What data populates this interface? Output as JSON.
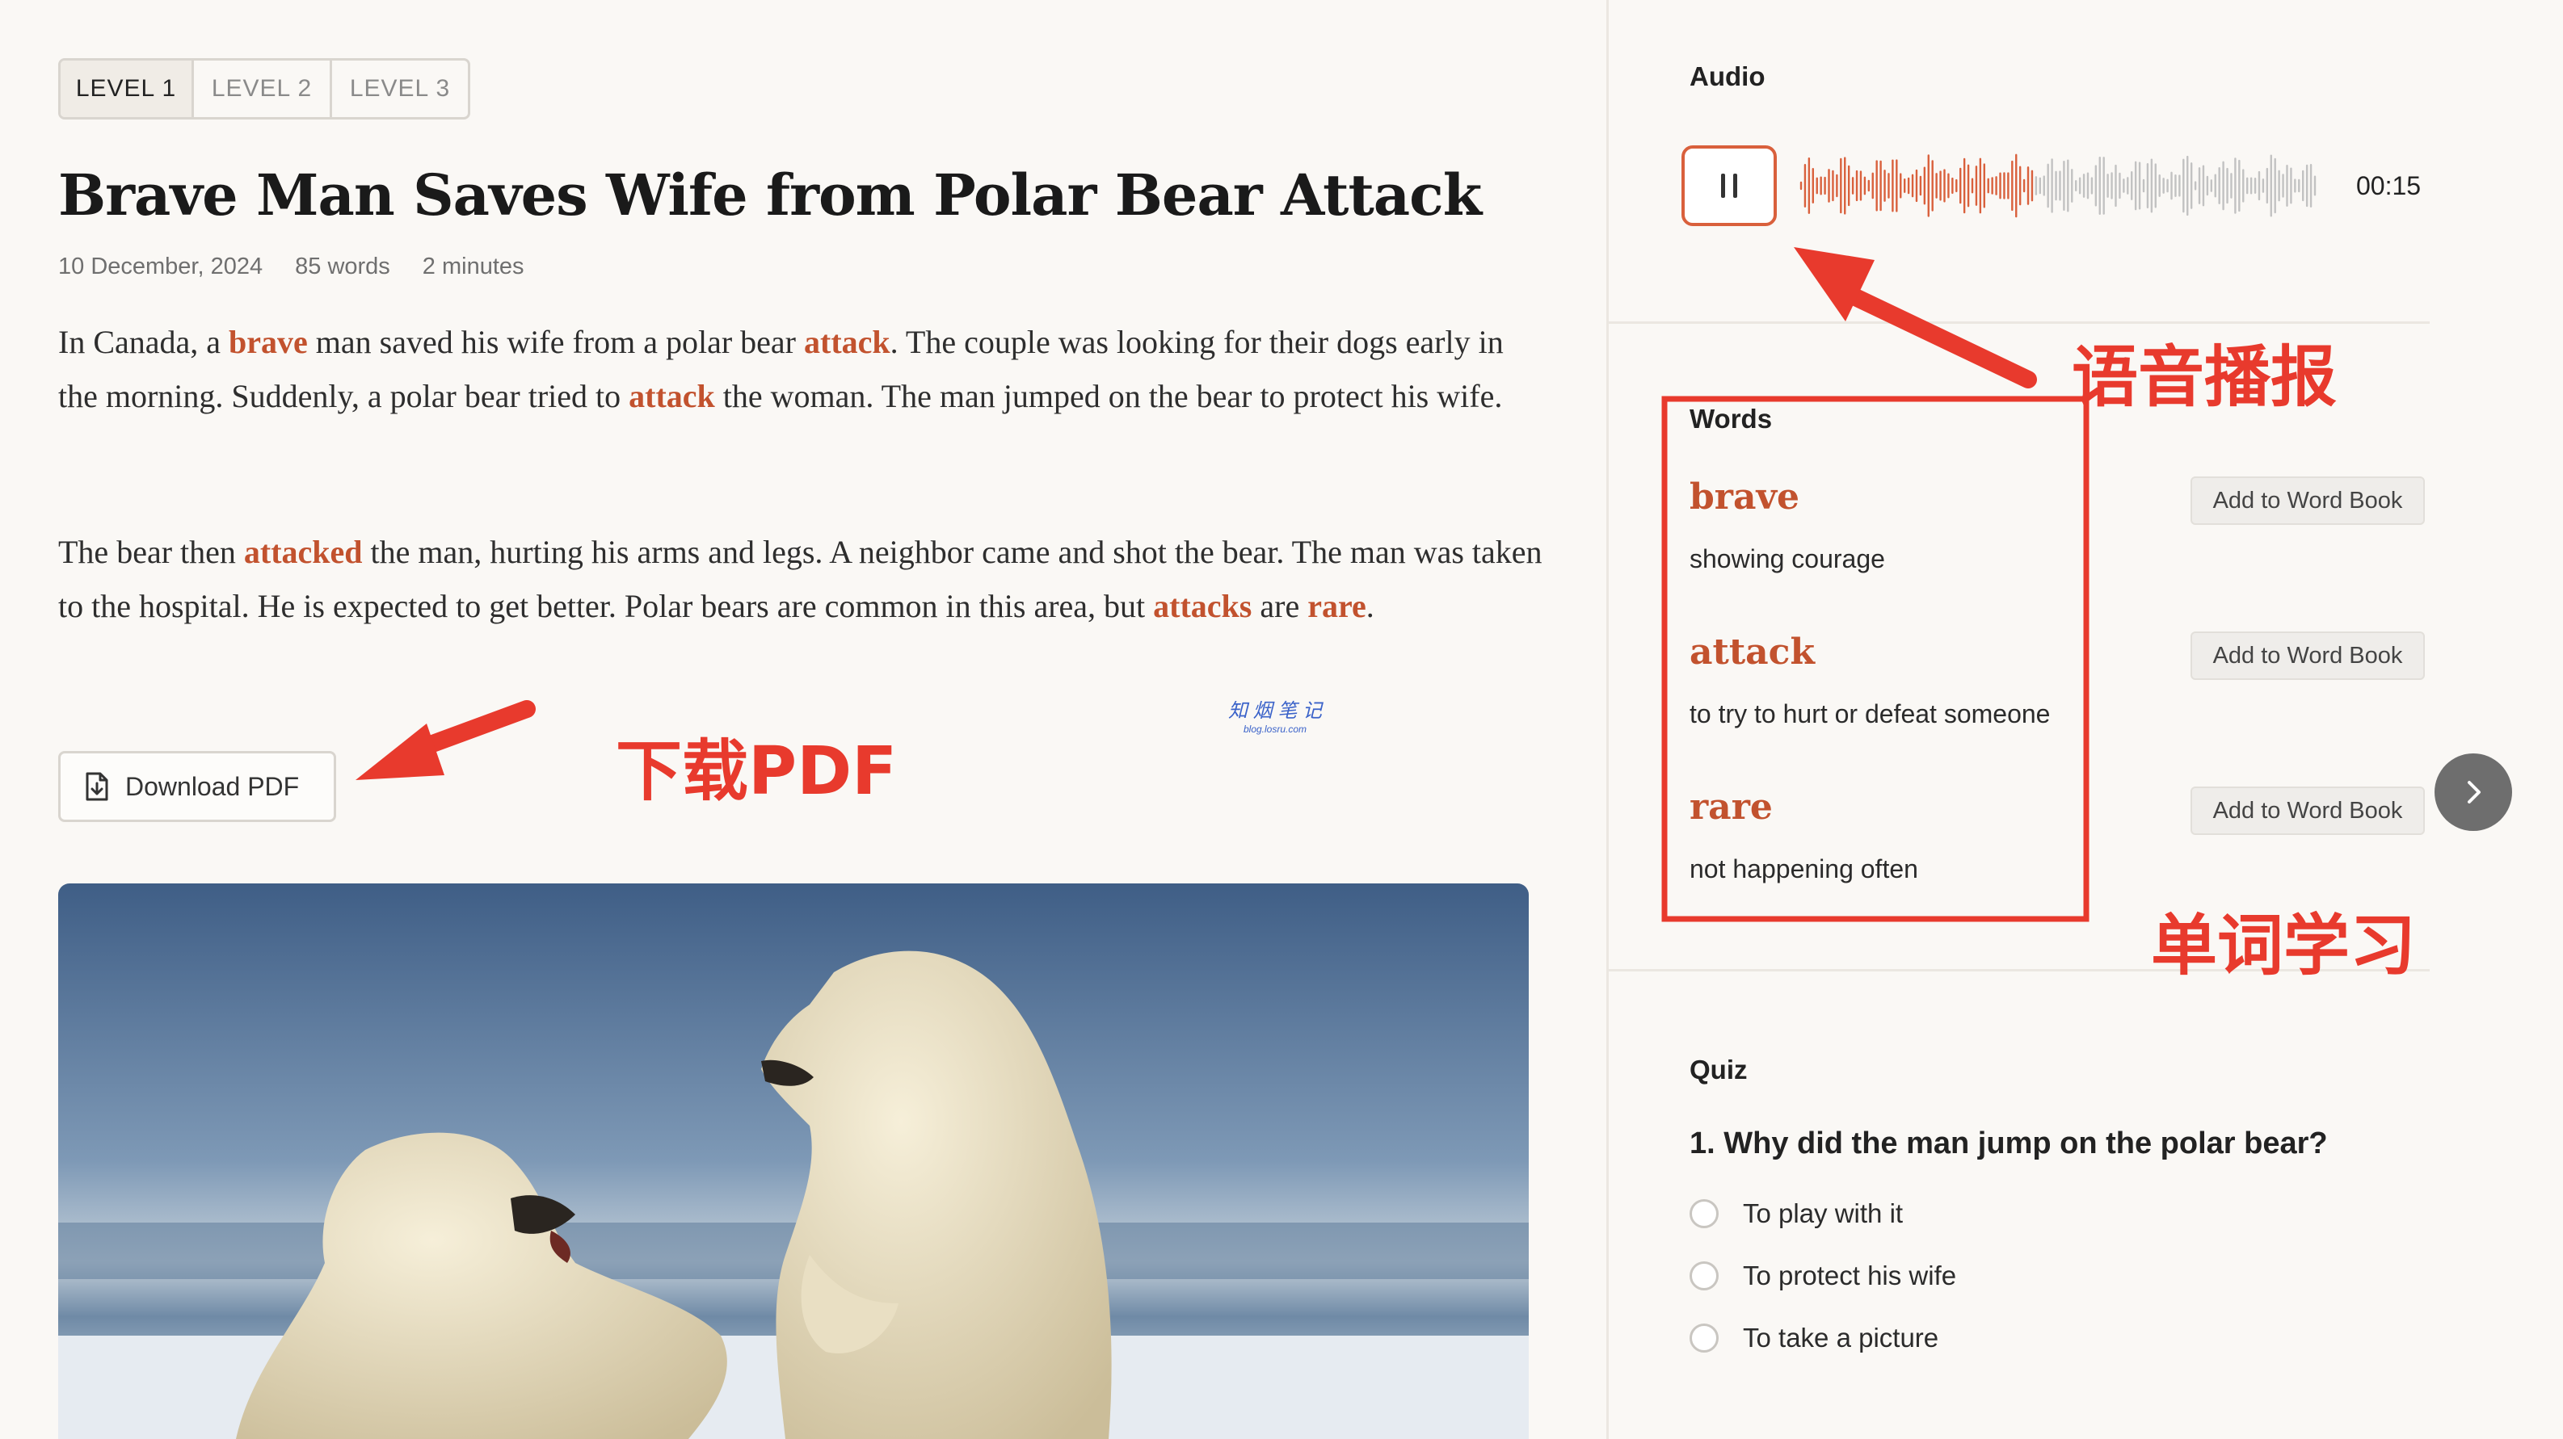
{
  "levels": [
    {
      "label": "LEVEL 1",
      "active": true
    },
    {
      "label": "LEVEL 2",
      "active": false
    },
    {
      "label": "LEVEL 3",
      "active": false
    }
  ],
  "article": {
    "title": "Brave Man Saves Wife from Polar Bear Attack",
    "date": "10 December, 2024",
    "word_count": "85 words",
    "read_time": "2 minutes",
    "p1": {
      "t1": "In Canada, a ",
      "k1": "brave",
      "t2": " man saved his wife from a polar bear ",
      "k2": "attack",
      "t3": ". The couple was looking for their dogs early in the morning. Suddenly, a polar bear tried to ",
      "k3": "attack",
      "t4": " the woman. The man jumped on the bear to protect his wife."
    },
    "p2": {
      "t1": "The bear then ",
      "k1": "attacked",
      "t2": " the man, hurting his arms and legs. A neighbor came and shot the bear. The man was taken to the hospital. He is expected to get better. Polar bears are common in this area, but ",
      "k2": "attacks",
      "t3": " are ",
      "k3": "rare",
      "t4": "."
    },
    "download_label": "Download PDF",
    "watermark_top": "知 烟 笔 记",
    "watermark_bottom": "blog.losru.com"
  },
  "annotations": {
    "download": "下载PDF",
    "audio": "语音播报",
    "words": "单词学习",
    "color": "#e83a2d"
  },
  "audio": {
    "label": "Audio",
    "time": "00:15",
    "played_fraction": 0.45,
    "accent": "#d9603c"
  },
  "words": {
    "label": "Words",
    "button_label": "Add to Word Book",
    "items": [
      {
        "word": "brave",
        "definition": "showing courage"
      },
      {
        "word": "attack",
        "definition": "to try to hurt or defeat someone"
      },
      {
        "word": "rare",
        "definition": "not happening often"
      }
    ]
  },
  "quiz": {
    "label": "Quiz",
    "question": "1. Why did the man jump on the polar bear?",
    "options": [
      "To play with it",
      "To protect his wife",
      "To take a picture"
    ]
  },
  "icons": {
    "download": "file-download-icon",
    "pause": "pause-icon",
    "next": "chevron-right-icon"
  }
}
